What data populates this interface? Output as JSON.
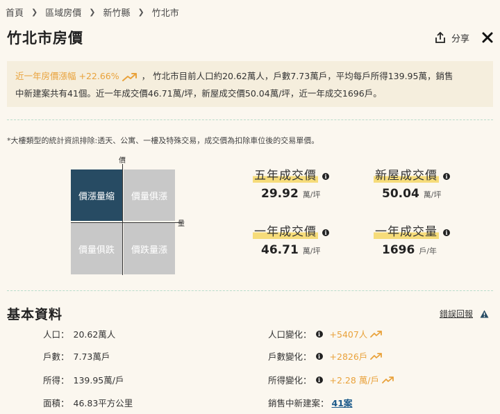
{
  "breadcrumb": {
    "items": [
      "首頁",
      "區域房價",
      "新竹縣",
      "竹北市"
    ]
  },
  "header": {
    "title": "竹北市房價",
    "share_label": "分享"
  },
  "summary": {
    "rise_label": "近一年房價漲幅 +22.66%",
    "text_line1": "， 竹北市目前人口約20.62萬人，戶數7.73萬戶，平均每戶所得139.95萬，銷售",
    "text_line2": "中新建案共有41個。近一年成交價46.71萬/坪，新屋成交價50.04萬/坪，近一年成交1696戶。"
  },
  "note": "*大樓類型的統計資訊排除:透天、公寓、一樓及特殊交易，成交價為扣除車位後的交易單價。",
  "quadrant": {
    "axis_y": "價",
    "axis_x": "量",
    "cells": [
      "價漲量縮",
      "價量俱漲",
      "價量俱跌",
      "價跌量漲"
    ],
    "active_index": 0
  },
  "stats": [
    {
      "label": "五年成交價",
      "value": "29.92",
      "unit": "萬/坪"
    },
    {
      "label": "新屋成交價",
      "value": "50.04",
      "unit": "萬/坪"
    },
    {
      "label": "一年成交價",
      "value": "46.71",
      "unit": "萬/坪"
    },
    {
      "label": "一年成交量",
      "value": "1696",
      "unit": "戶/年"
    }
  ],
  "basic": {
    "title": "基本資料",
    "report_label": "錯誤回報",
    "left": [
      {
        "label": "人口：",
        "value": "20.62萬人"
      },
      {
        "label": "戶數：",
        "value": "7.73萬戶"
      },
      {
        "label": "所得：",
        "value": "139.95萬/戶"
      },
      {
        "label": "面積：",
        "value": "46.83平方公里"
      }
    ],
    "right": [
      {
        "label": "人口變化：",
        "value": "+5407人"
      },
      {
        "label": "戶數變化：",
        "value": "+2826戶"
      },
      {
        "label": "所得變化：",
        "value": "+2.28 萬/戶"
      }
    ],
    "new_projects_label": "銷售中新建案：",
    "new_projects_value": "41案"
  },
  "colors": {
    "accent_orange": "#e9a23b",
    "active_quadrant": "#274b63",
    "highlight": "#f6dc7a",
    "link": "#1c5a8a"
  }
}
